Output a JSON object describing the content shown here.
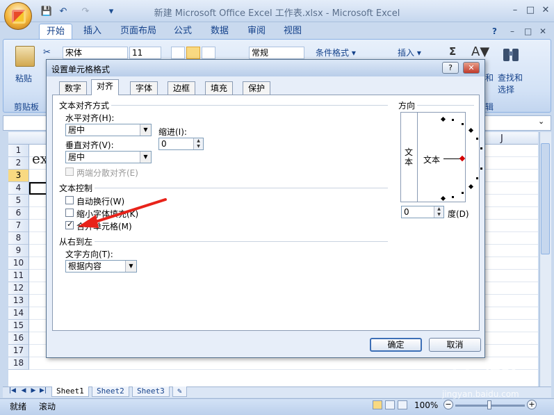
{
  "window": {
    "title": "新建 Microsoft Office Excel 工作表.xlsx - Microsoft Excel",
    "min": "–",
    "max": "□",
    "close": "✕"
  },
  "qat": {
    "save": "💾",
    "undo": "↶",
    "redo": "↷",
    "customize": "▾"
  },
  "ribbon": {
    "tabs": [
      "开始",
      "插入",
      "页面布局",
      "公式",
      "数据",
      "审阅",
      "视图"
    ],
    "help": "?",
    "ribbon_min": "–",
    "ribbon_max": "□",
    "ribbon_close": "✕",
    "paste_label": "粘贴",
    "clipboard_group": "剪贴板",
    "font_name": "宋体",
    "font_size": "11",
    "number_format": "常规",
    "conditional_format": "条件格式",
    "insert": "插入",
    "sum": "Σ",
    "find_select_1": "查找和",
    "find_select_2": "选择",
    "partial_1": "和",
    "partial_group": "辑"
  },
  "grid": {
    "rows": [
      "1",
      "2",
      "3",
      "4",
      "5",
      "6",
      "7",
      "8",
      "9",
      "10",
      "11",
      "12",
      "13",
      "14",
      "15",
      "16",
      "17",
      "18"
    ],
    "selected_row": "3",
    "col_j": "J",
    "cell_a1": "ex"
  },
  "sheets": {
    "tabs": [
      "Sheet1",
      "Sheet2",
      "Sheet3"
    ],
    "active": "Sheet1"
  },
  "status": {
    "ready": "就绪",
    "scroll": "滚动",
    "zoom": "100%",
    "zoom_level": 1.0
  },
  "dialog": {
    "title": "设置单元格格式",
    "help_btn": "?",
    "close_btn": "✕",
    "tabs": [
      "数字",
      "对齐",
      "字体",
      "边框",
      "填充",
      "保护"
    ],
    "active_tab": "对齐",
    "text_align_section": "文本对齐方式",
    "horizontal_label": "水平对齐(H):",
    "horizontal_value": "居中",
    "indent_label": "缩进(I):",
    "indent_value": "0",
    "vertical_label": "垂直对齐(V):",
    "vertical_value": "居中",
    "justify_distributed": "两端分散对齐(E)",
    "text_control_section": "文本控制",
    "wrap_text": "自动换行(W)",
    "shrink_to_fit": "缩小字体填充(K)",
    "merge_cells": "合并单元格(M)",
    "merge_checked": true,
    "rtl_section": "从右到左",
    "text_direction_label": "文字方向(T):",
    "text_direction_value": "根据内容",
    "orientation_section": "方向",
    "orientation_vertical_text": "文本",
    "orientation_text": "文本",
    "degrees_value": "0",
    "degrees_label": "度(D)",
    "ok": "确定",
    "cancel": "取消"
  },
  "colors": {
    "accent": "#15428b",
    "selection": "#f9d981",
    "annotation_arrow": "#e8231a"
  },
  "watermark": {
    "brand": "Baidu经验",
    "url": "jingyan.baidu.com"
  }
}
